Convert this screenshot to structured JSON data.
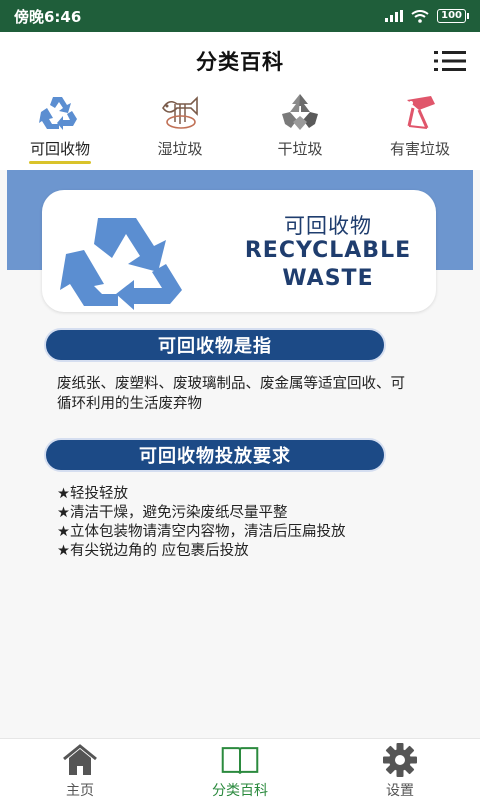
{
  "status_bar": {
    "time": "傍晚6:46",
    "battery": "100"
  },
  "header": {
    "title": "分类百科",
    "menu_icon": "list-menu-icon"
  },
  "tabs": [
    {
      "label": "可回收物",
      "icon": "recycle-icon",
      "active": true
    },
    {
      "label": "湿垃圾",
      "icon": "fishbone-icon",
      "active": false
    },
    {
      "label": "干垃圾",
      "icon": "dry-waste-icon",
      "active": false
    },
    {
      "label": "有害垃圾",
      "icon": "hazard-icon",
      "active": false
    }
  ],
  "banner": {
    "title_cn": "可回收物",
    "title_en_line1": "RECYCLABLE",
    "title_en_line2": "WASTE"
  },
  "definition": {
    "heading": "可回收物是指",
    "text": "废纸张、废塑料、废玻璃制品、废金属等适宜回收、可循环利用的生活废弃物"
  },
  "requirements": {
    "heading": "可回收物投放要求",
    "items": [
      "★轻投轻放",
      "★清洁干燥，避免污染废纸尽量平整",
      "★立体包装物请清空内容物，清洁后压扁投放",
      "★有尖锐边角的 应包裹后投放"
    ]
  },
  "bottom_nav": [
    {
      "label": "主页",
      "icon": "home-icon",
      "active": false
    },
    {
      "label": "分类百科",
      "icon": "book-icon",
      "active": true
    },
    {
      "label": "设置",
      "icon": "gear-icon",
      "active": false
    }
  ],
  "colors": {
    "status_bar": "#1f5e3a",
    "accent_blue": "#1c4a86",
    "banner_blue": "#6d96cf",
    "tab_underline": "#d9c32a",
    "nav_active": "#2b8a3e"
  }
}
